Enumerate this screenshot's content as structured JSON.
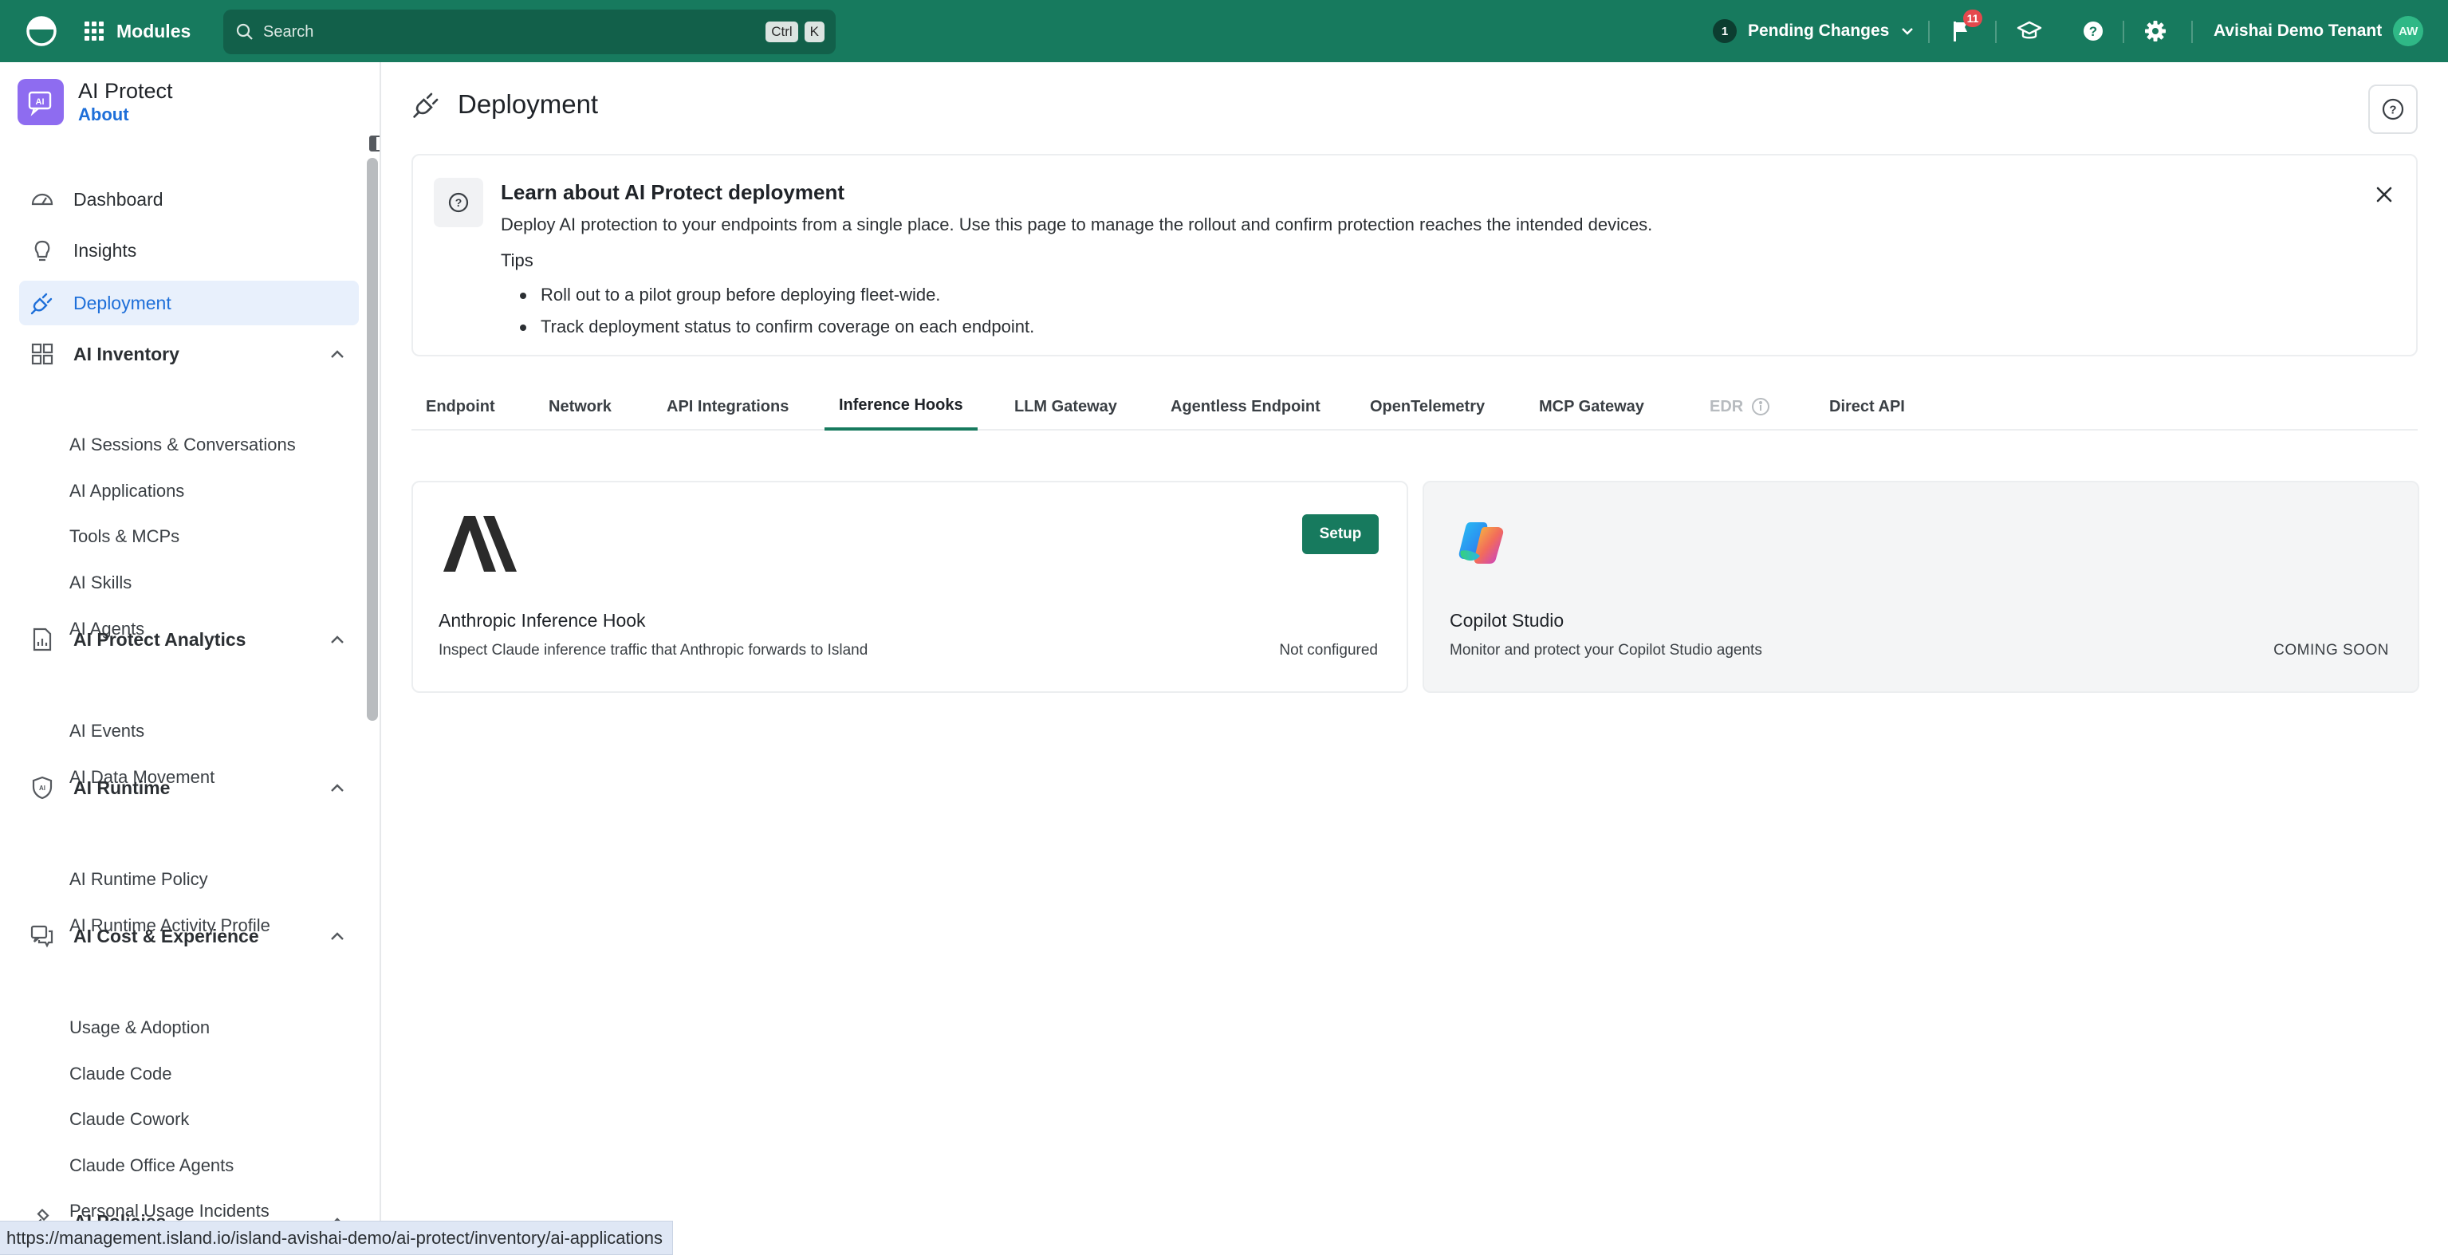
{
  "topbar": {
    "modules_label": "Modules",
    "search_placeholder": "Search",
    "search_shortcut_ctrl": "Ctrl",
    "search_shortcut_key": "K",
    "pending_count": "1",
    "pending_label": "Pending Changes",
    "notifications_count": "11",
    "tenant_name": "Avishai Demo Tenant",
    "avatar_initials": "AW",
    "brand_color": "#177a5e"
  },
  "sidebar": {
    "app_title": "AI Protect",
    "app_subtitle": "About",
    "nav": {
      "dashboard": "Dashboard",
      "insights": "Insights",
      "deployment": "Deployment",
      "ai_inventory": "AI Inventory",
      "ai_protect_analytics": "AI Protect Analytics",
      "ai_runtime": "AI Runtime",
      "ai_cost_experience": "AI Cost & Experience",
      "ai_policies": "AI Policies"
    },
    "inventory_items": [
      "AI Sessions & Conversations",
      "AI Applications",
      "Tools & MCPs",
      "AI Skills",
      "AI Agents"
    ],
    "analytics_items": [
      "AI Events",
      "AI Data Movement"
    ],
    "runtime_items": [
      "AI Runtime Policy",
      "AI Runtime Activity Profile"
    ],
    "cost_items": [
      "Usage & Adoption",
      "Claude Code",
      "Claude Cowork",
      "Claude Office Agents",
      "Personal Usage Incidents"
    ]
  },
  "main": {
    "page_title": "Deployment",
    "banner": {
      "title": "Learn about AI Protect deployment",
      "description": "Deploy AI protection to your endpoints from a single place. Use this page to manage the rollout and confirm protection reaches the intended devices.",
      "tips_label": "Tips",
      "tips": [
        "Roll out to a pilot group before deploying fleet-wide.",
        "Track deployment status to confirm coverage on each endpoint."
      ]
    },
    "tabs": [
      "Endpoint",
      "Network",
      "API Integrations",
      "Inference Hooks",
      "LLM Gateway",
      "Agentless Endpoint",
      "OpenTelemetry",
      "MCP Gateway",
      "EDR",
      "Direct API"
    ],
    "active_tab": "Inference Hooks",
    "cards": [
      {
        "title": "Anthropic Inference Hook",
        "description": "Inspect Claude inference traffic that Anthropic forwards to Island",
        "status": "Not configured",
        "action_label": "Setup"
      },
      {
        "title": "Copilot Studio",
        "description": "Monitor and protect your Copilot Studio agents",
        "status": "COMING SOON"
      }
    ]
  },
  "status_bar": {
    "url": "https://management.island.io/island-avishai-demo/ai-protect/inventory/ai-applications"
  }
}
